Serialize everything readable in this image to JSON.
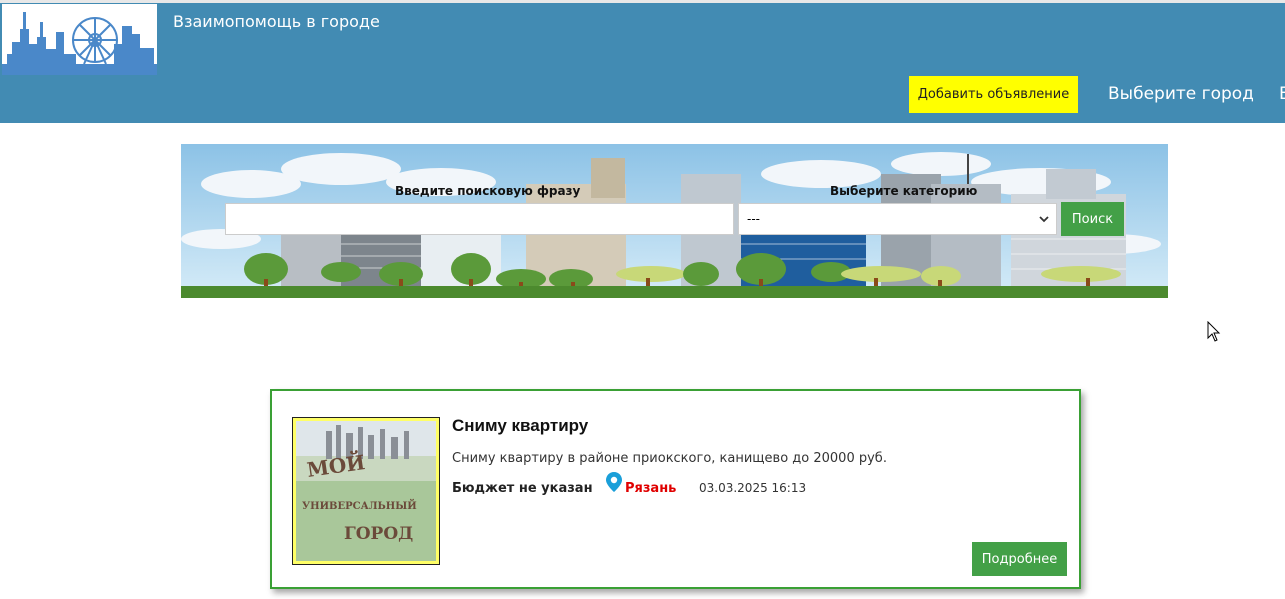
{
  "header": {
    "site_title": "Взаимопомощь в городе",
    "add_button": "Добавить объявление",
    "city_selector": "Выберите город",
    "cut_link": "В",
    "bg_color": "#428bb3",
    "accent_yellow": "#ffff00"
  },
  "search": {
    "phrase_label": "Введите поисковую фразу",
    "phrase_value": "",
    "category_label": "Выберите категорию",
    "category_selected": "---",
    "search_button": "Поиск"
  },
  "listing": {
    "title": "Сниму квартиру",
    "description": "Сниму квартиру в районе приокского, канищево до 20000 руб.",
    "budget": "Бюджет не указан",
    "city": "Рязань",
    "date": "03.03.2025 16:13",
    "details_button": "Подробнее",
    "thumb_caption": "МОЙ УНИВЕРСАЛЬНЫЙ ГОРОД",
    "border_color": "#3aa035"
  },
  "icons": {
    "logo": "city-skyline-logo",
    "location": "map-pin-icon",
    "dropdown": "chevron-down-icon",
    "cursor": "mouse-pointer-icon"
  }
}
